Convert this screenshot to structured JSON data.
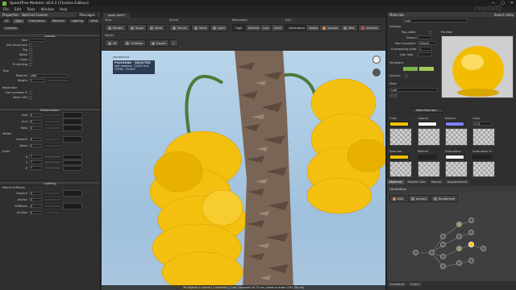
{
  "window": {
    "title": "SpeedTree Modeler v8.0.2 [Cinema Edition]",
    "controls": [
      "—",
      "▢",
      "✕"
    ]
  },
  "menu": [
    "File",
    "Edit",
    "Tools",
    "Window",
    "Help"
  ],
  "logo": "rephiQ",
  "left": {
    "panel_title": "Properties - Batched Leaves",
    "messages_tab": "Messages",
    "tools": [
      "All",
      "Gen",
      "Orientation",
      "Material",
      "Lighting",
      "Wind"
    ],
    "collision": "Collision",
    "leaves_header": "Leaves",
    "leaves_rows": [
      "Size",
      "Use actual size",
      "Flip",
      "Width",
      "Cross",
      "Tri winding"
    ],
    "type_label": "Type",
    "material_label": "Material",
    "material_value": "Leaf",
    "weight_label": "Weight",
    "weight_value": "1",
    "resolution_label": "Resolution",
    "size_increase": "Size increase %",
    "mesh_lod": "Mesh LOD",
    "deformation_header": "Deformation",
    "deform_rows": [
      {
        "label": "Fold",
        "value": "0"
      },
      {
        "label": "Curl",
        "value": "0"
      },
      {
        "label": "Twist",
        "value": "0"
      }
    ],
    "vertex_label": "Vertex",
    "vertex_rows": [
      {
        "label": "Amount",
        "value": "0"
      },
      {
        "label": "Noise",
        "value": "0"
      }
    ],
    "scale_label": "Scale",
    "scale_rows": [
      {
        "label": "X",
        "value": "1"
      },
      {
        "label": "Y",
        "value": "1"
      },
      {
        "label": "Z",
        "value": "1"
      }
    ],
    "lighting_header": "Lighting",
    "lighting_sub": "Parent Puffiness",
    "lighting_rows": [
      {
        "label": "Amount",
        "value": "0"
      },
      {
        "label": "Anchor",
        "value": "0"
      },
      {
        "label": "Puffiness",
        "value": "0"
      },
      {
        "label": "AO bias",
        "value": "0"
      }
    ]
  },
  "viewport": {
    "tab": "palm.spm*",
    "groups": {
      "view": "View",
      "scene": "Scene",
      "resolution": "Resolution",
      "edit": "Edit",
      "model": "Model"
    },
    "view_buttons": [
      "Render",
      "Show",
      "Wind"
    ],
    "scene_buttons": [
      "Forces",
      "Wind",
      "Light"
    ],
    "resolution_buttons": [
      "High",
      "Medium",
      "Low",
      "Draft"
    ],
    "edit_buttons": [
      "Generators",
      "Nodes",
      "Season",
      "Wall",
      "Selektor"
    ],
    "model_buttons": [
      "All",
      "Collision",
      "Export",
      "←"
    ],
    "perspective": "perspective",
    "selection_lines": [
      "POLYGONS - SELECTED",
      "leaf meshes: 70,920 tris",
      "TOTAL: 70,920"
    ],
    "status": "26 objects in scene (1 selected) | Last Compute 44.74 ms (draw to draw 1241.36 ms)"
  },
  "right": {
    "materials_title": "Materials",
    "search_label": "Search Help",
    "material_name": "Leaf",
    "preview_label": "Preview",
    "settings_label": "Settings",
    "settings_rows": [
      {
        "label": "Two-sided",
        "value": ""
      },
      {
        "label": "Season",
        "value": ""
      },
      {
        "label": "Max resolution",
        "value": "Default"
      },
      {
        "label": "Unwrapping scale",
        "value": "1"
      },
      {
        "label": "Leaf data",
        "value": ""
      }
    ],
    "variations_label": "Variations",
    "amount_label": "Amount",
    "mesh_label": "Mesh",
    "mesh_value": "Leaf",
    "make_new_set": "Make New Set...",
    "channels_top": [
      "Color",
      "Opacity",
      "Normal",
      "Gloss"
    ],
    "channels_bottom": [
      "Specular",
      "Metallic",
      "Subsurface",
      "Subsurface %"
    ],
    "color_swatch": "#f2c200",
    "opacity_swatch": "#ffffff",
    "normal_swatch": "#8080ff",
    "gloss_value": "0.25",
    "specular_swatch": "#f0c000",
    "subsurface_swatch": "#f5f5f5",
    "bottom_tabs": [
      "Materials",
      "Material Sets",
      "Meshes",
      "Displacements"
    ],
    "generation_title": "Generation",
    "gen_buttons": [
      "Add",
      "Actions",
      "Randomize"
    ],
    "bottom_panel_tabs": [
      "Generation",
      "Output"
    ]
  },
  "colors": {
    "leaf": "#f4c010",
    "bark": "#7a6455",
    "sky": "#b6d2ea",
    "branch": "#4d7a3a"
  }
}
